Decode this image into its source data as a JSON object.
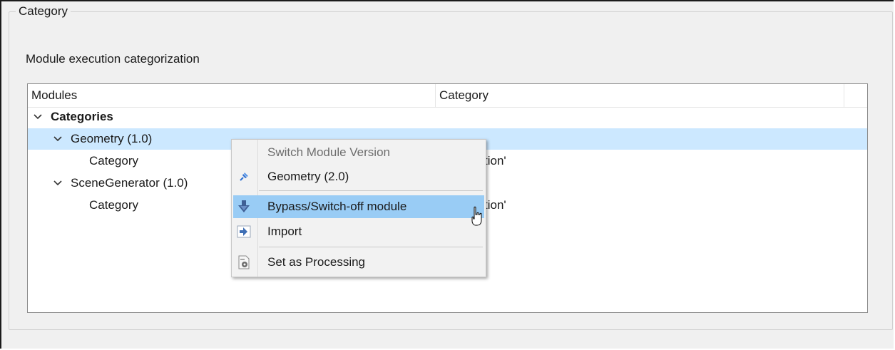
{
  "group": {
    "title": "Category"
  },
  "section": {
    "label": "Module execution categorization"
  },
  "tree": {
    "columns": [
      "Modules",
      "Category"
    ],
    "rows": [
      {
        "label": "Categories",
        "category": "",
        "expanded": true
      },
      {
        "label": "Geometry (1.0)",
        "category": "",
        "expanded": true,
        "selected": true
      },
      {
        "label": "Category",
        "category": "tion'"
      },
      {
        "label": "SceneGenerator (1.0)",
        "category": "",
        "expanded": true
      },
      {
        "label": "Category",
        "category": "tion'"
      }
    ]
  },
  "context_menu": {
    "header": "Switch Module Version",
    "items": [
      {
        "label": "Geometry (2.0)",
        "icon": "pin-icon"
      },
      {
        "label": "Bypass/Switch-off module",
        "icon": "bypass-arrow-icon",
        "hovered": true
      },
      {
        "label": "Import",
        "icon": "import-icon"
      },
      {
        "label": "Set as Processing",
        "icon": "processing-icon"
      }
    ]
  },
  "colors": {
    "selection": "#cce8ff",
    "menu_hover": "#99ccf5",
    "menu_background": "#f2f2f2"
  }
}
